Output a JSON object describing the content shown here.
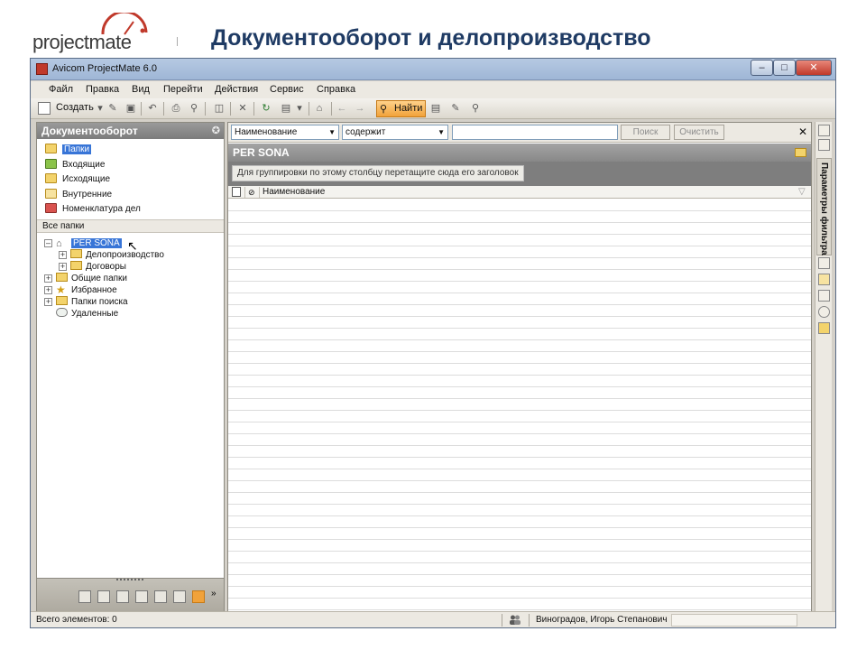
{
  "banner": {
    "logo_text": "projectmate",
    "title": "Документооборот и делопроизводство"
  },
  "window": {
    "title": "Avicom ProjectMate 6.0"
  },
  "menu": [
    "Файл",
    "Правка",
    "Вид",
    "Перейти",
    "Действия",
    "Сервис",
    "Справка"
  ],
  "toolbar": {
    "create_label": "Создать",
    "find_label": "Найти"
  },
  "left_panel": {
    "header": "Документооборот",
    "nav": [
      "Папки",
      "Входящие",
      "Исходящие",
      "Внутренние",
      "Номенклатура дел"
    ],
    "all_folders_label": "Все папки",
    "tree": {
      "root": "PER SONA",
      "children": [
        "Делопроизводство",
        "Договоры"
      ],
      "other": [
        "Общие папки",
        "Избранное",
        "Папки поиска",
        "Удаленные"
      ]
    }
  },
  "filter": {
    "field": "Наименование",
    "operator": "содержит",
    "search_value": "",
    "search_button": "Поиск",
    "clear_button": "Очистить"
  },
  "grid": {
    "title": "PER SONA",
    "group_hint": "Для группировки по этому столбцу перетащите сюда его заголовок",
    "columns": [
      "Наименование"
    ]
  },
  "right_strip": {
    "filter_params_label": "Параметры фильтра"
  },
  "status": {
    "items_count": "Всего элементов: 0",
    "user": "Виноградов, Игорь Степанович"
  },
  "colors": {
    "accent_orange": "#f1a23a",
    "selection_blue": "#3875d7",
    "title_navy": "#1f3b64"
  }
}
